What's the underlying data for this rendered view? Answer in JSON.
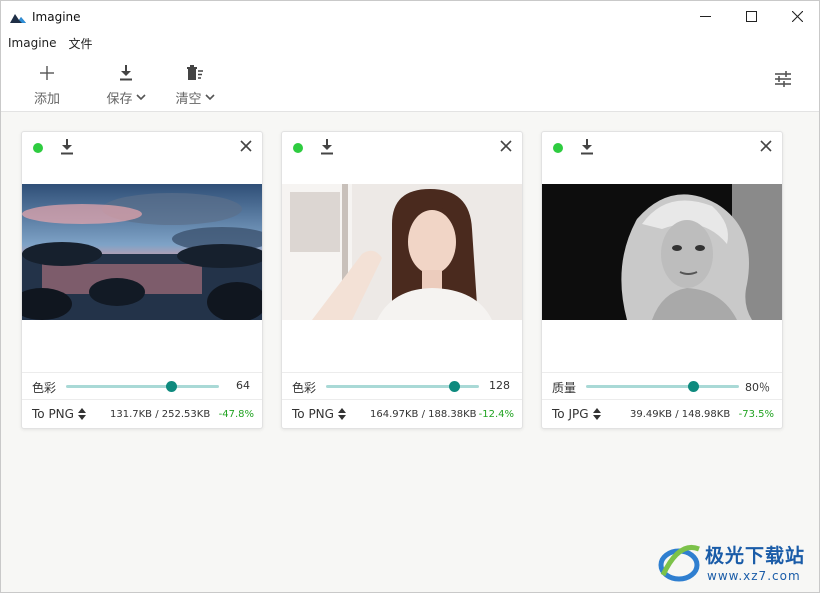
{
  "window": {
    "title": "Imagine"
  },
  "menu": [
    "Imagine",
    "文件"
  ],
  "toolbar": {
    "add_label": "添加",
    "save_label": "保存",
    "clear_label": "清空"
  },
  "cards": [
    {
      "image": "landscape-sunset-lake",
      "slider_label": "色彩",
      "slider_value": "64",
      "slider_fraction": 0.69,
      "format": "To PNG",
      "sizes": "131.7KB / 252.53KB",
      "change": "-47.8%"
    },
    {
      "image": "portrait-woman-color",
      "slider_label": "色彩",
      "slider_value": "128",
      "slider_fraction": 0.84,
      "format": "To PNG",
      "sizes": "164.97KB / 188.38KB",
      "change": "-12.4%"
    },
    {
      "image": "portrait-woman-bw",
      "slider_label": "质量",
      "slider_value": "80％",
      "slider_fraction": 0.7,
      "format": "To JPG",
      "sizes": "39.49KB / 148.98KB",
      "change": "-73.5%"
    }
  ],
  "colors": {
    "status_ok": "#2ecc40",
    "slider_knob": "#0e8a7e",
    "slider_track": "#a9d9d6",
    "savings": "#22a322"
  },
  "watermark": {
    "title": "极光下载站",
    "url": "www.xz7.com"
  }
}
